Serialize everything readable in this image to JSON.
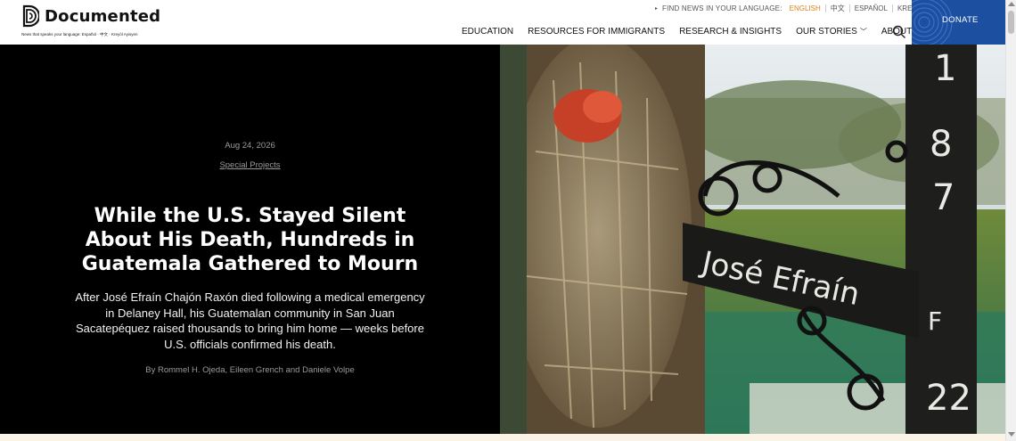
{
  "header": {
    "logo_text": "Documented",
    "tagline": "News that speaks your language: Español · 中文 · Kreyòl Ayisyen",
    "language_bar": {
      "prompt": "FIND NEWS IN YOUR LANGUAGE:",
      "languages": [
        "ENGLISH",
        "中文",
        "ESPAÑOL",
        "KREYOL"
      ],
      "active": "ENGLISH"
    },
    "nav": [
      "EDUCATION",
      "RESOURCES FOR IMMIGRANTS",
      "RESEARCH & INSIGHTS",
      "OUR STORIES",
      "ABOUT US"
    ],
    "donate_label": "DONATE"
  },
  "hero": {
    "date": "Aug 24, 2026",
    "category": "Special Projects",
    "title": "While the U.S. Stayed Silent About His Death, Hundreds in Guatemala Gathered to Mourn",
    "dek": "After José Efraín Chajón Raxón died following a medical emergency in Delaney Hall, his Guatemalan community in San Juan Sacatepéquez raised thousands to bring him home — weeks before U.S. officials confirmed his death.",
    "byline": "By Rommel H. Ojeda, Eileen Grench and Daniele Volpe",
    "image_sign_text": "José Efraín"
  },
  "colors": {
    "accent_language": "#d9831f",
    "donate_bg": "#1d4fa0",
    "hero_bg": "#000000"
  }
}
